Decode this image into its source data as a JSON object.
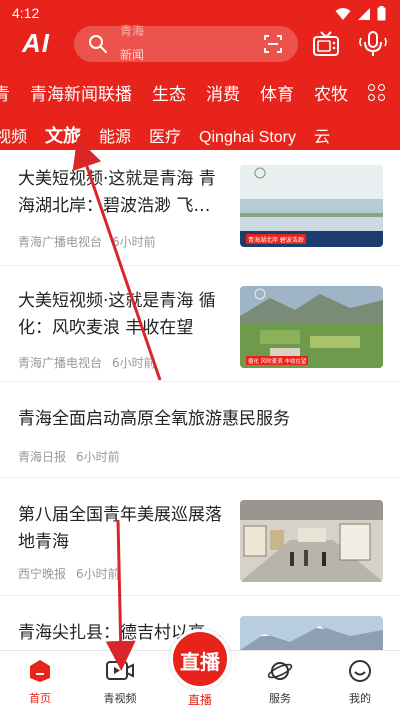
{
  "status": {
    "time": "4:12"
  },
  "header": {
    "logo": "AI",
    "search_hint_top": "青海",
    "search_hint": "新闻"
  },
  "channels": [
    "青海新闻联播",
    "生态",
    "消费",
    "体育",
    "农牧"
  ],
  "channel_partial_left": "青",
  "subtabs": [
    "视频",
    "文旅",
    "能源",
    "医疗",
    "Qinghai Story",
    "云"
  ],
  "active_subtab": "文旅",
  "articles": [
    {
      "title": "大美短视频·这就是青海 青海湖北岸：碧波浩渺 飞…",
      "source": "青海广播电视台",
      "time": "6小时前",
      "thumb": "lake"
    },
    {
      "title": "大美短视频·这就是青海 循化：风吹麦浪 丰收在望",
      "source": "青海广播电视台",
      "time": "6小时前",
      "thumb": "field"
    },
    {
      "title": "青海全面启动高原全氧旅游惠民服务",
      "source": "青海日报",
      "time": "6小时前",
      "thumb": ""
    },
    {
      "title": "第八届全国青年美展巡展落地青海",
      "source": "西宁晚报",
      "time": "6小时前",
      "thumb": "gallery"
    },
    {
      "title": "青海尖扎县：德吉村以高…",
      "source": "",
      "time": "",
      "thumb": "mountain"
    }
  ],
  "thumb_caption_lake": "青海湖北岸 碧波浩渺",
  "thumb_caption_field": "循化 风吹麦浪 丰收在望",
  "bottom_nav": {
    "home": "首页",
    "video": "青视频",
    "live_button": "直播",
    "live": "直播",
    "service": "服务",
    "mine": "我的"
  },
  "colors": {
    "brand": "#e8231b",
    "text": "#222222",
    "meta": "#999999"
  }
}
